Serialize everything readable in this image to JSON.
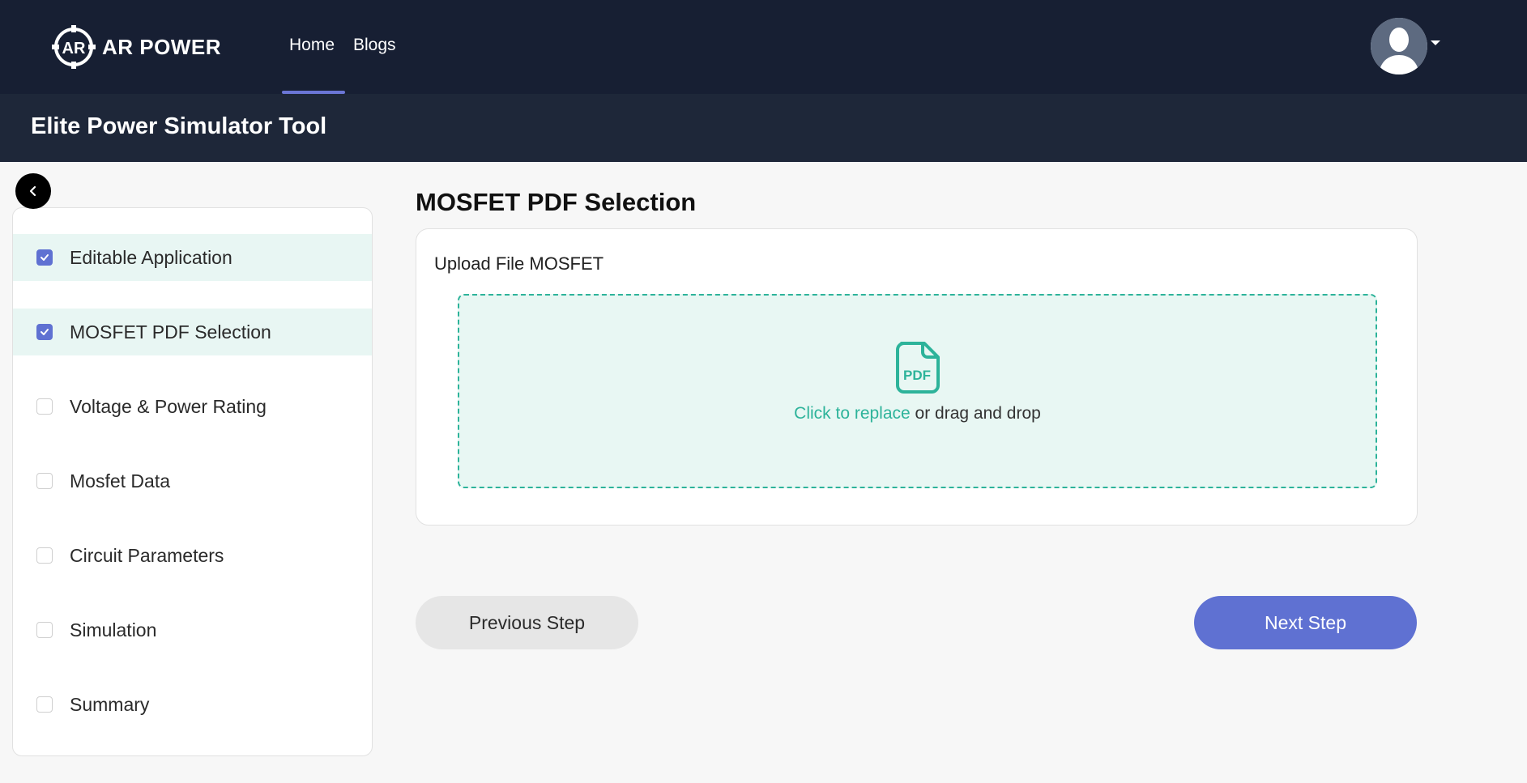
{
  "nav": {
    "brand": "AR POWER",
    "links": [
      {
        "label": "Home",
        "active": true
      },
      {
        "label": "Blogs",
        "active": false
      }
    ],
    "logo_icon": "ar-circle-logo",
    "avatar_icon": "user-avatar"
  },
  "page": {
    "title": "Elite Power Simulator Tool"
  },
  "sidebar": {
    "collapse_icon": "chevron-left-icon",
    "steps": [
      {
        "label": "Editable Application",
        "checked": true
      },
      {
        "label": "MOSFET PDF Selection",
        "checked": true
      },
      {
        "label": "Voltage & Power Rating",
        "checked": false
      },
      {
        "label": "Mosfet Data",
        "checked": false
      },
      {
        "label": "Circuit Parameters",
        "checked": false
      },
      {
        "label": "Simulation",
        "checked": false
      },
      {
        "label": "Summary",
        "checked": false
      }
    ]
  },
  "main": {
    "heading": "MOSFET PDF Selection",
    "upload_label": "Upload File MOSFET",
    "dropzone": {
      "icon": "pdf-file-icon",
      "link_text": "Click to replace",
      "rest_text": " or drag and drop"
    },
    "prev_button": "Previous Step",
    "next_button": "Next Step"
  },
  "colors": {
    "nav_bg": "#171f33",
    "title_bg": "#1e2739",
    "accent": "#5f71d2",
    "teal": "#2db39a",
    "done_bg": "#e8f6f3"
  }
}
